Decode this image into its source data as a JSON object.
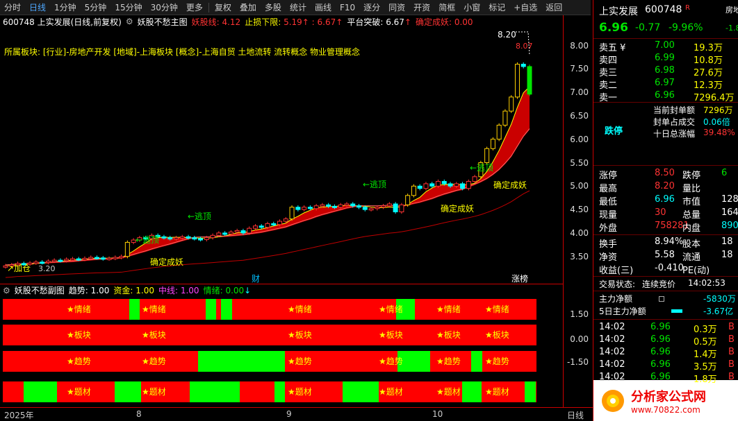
{
  "toolbar": {
    "items": [
      "分时",
      "日线",
      "1分钟",
      "5分钟",
      "15分钟",
      "30分钟",
      "更多"
    ],
    "items2": [
      "复权",
      "叠加",
      "多股",
      "统计",
      "画线",
      "F10",
      "逐分",
      "同资",
      "开资",
      "简框",
      "小窗",
      "标记",
      "+自选",
      "返回"
    ]
  },
  "info": {
    "code_name": "600748 上实发展(日线,前复权)",
    "indicator": "妖股不愁主图",
    "yao_label": "妖股线:",
    "yao_val": "4.12",
    "stop_label": "止损下限:",
    "stop_val": "5.19",
    "stop_val2": ": 6.67",
    "plat_label": "平台突破:",
    "plat_val": "6.67",
    "confirm_label": "确定成妖:",
    "confirm_val": "0.00"
  },
  "plate": "所属板块: [行业]-房地产开发 [地域]-上海板块 [概念]-上海自贸 土地流转 流转概念 物业管理概念",
  "annot": {
    "escape": "←逃顶",
    "confirm": "确定成妖",
    "buy": "↗加仓",
    "high": "8.20",
    "price8": "8.07",
    "low": "3.20",
    "cai": "财",
    "zb": "涨榜"
  },
  "yaxis": {
    "main": [
      "8.00",
      "7.50",
      "7.00",
      "6.50",
      "6.00",
      "5.50",
      "5.00",
      "4.50",
      "4.00",
      "3.50"
    ],
    "sub": [
      "1.50",
      "0.00",
      "-1.50"
    ]
  },
  "sub": {
    "title": "妖股不愁副图",
    "trend_label": "趋势:",
    "trend_val": "1.00",
    "fund_label": "资金:",
    "fund_val": "1.00",
    "mid_label": "中线:",
    "mid_val": "1.00",
    "mood_label": "情绪:",
    "mood_val": "0.00",
    "labels": [
      "★情绪",
      "★板块",
      "★趋势",
      "★题材"
    ]
  },
  "xaxis": {
    "labels": [
      "2025年",
      "8",
      "9",
      "10",
      "日线"
    ]
  },
  "right": {
    "title": "上实发展",
    "code": "600748",
    "r": "R",
    "ex": "房地",
    "price": "6.96",
    "chg": "-0.77",
    "pct": "-9.96%",
    "ex2": "-1.8",
    "asks": [
      {
        "l": "卖五 ¥",
        "p": "7.00",
        "v": "19.3万"
      },
      {
        "l": "卖四",
        "p": "6.99",
        "v": "10.8万"
      },
      {
        "l": "卖三",
        "p": "6.98",
        "v": "27.6万"
      },
      {
        "l": "卖二",
        "p": "6.97",
        "v": "12.3万"
      },
      {
        "l": "卖一",
        "p": "6.96",
        "v": "7296.4万"
      }
    ],
    "limit_label": "跌停",
    "seal_label": "当前封单额",
    "seal_val": "7296万",
    "seal_ratio_label": "封单占成交",
    "seal_ratio_val": "0.06倍",
    "ten_label": "十日总涨幅",
    "ten_val": "39.48%",
    "stats": [
      {
        "a": "涨停",
        "b": "8.50",
        "c": "跌停",
        "d": "6"
      },
      {
        "a": "最高",
        "b": "8.20",
        "c": "量比",
        "d": ""
      },
      {
        "a": "最低",
        "b": "6.96",
        "c": "市值",
        "d": "128"
      },
      {
        "a": "现量",
        "b": "30",
        "c": "总量",
        "d": "164"
      },
      {
        "a": "外盘",
        "b": "758281",
        "c": "内盘",
        "d": "890"
      }
    ],
    "stats2": [
      {
        "a": "换手",
        "b": "8.94%",
        "c": "股本",
        "d": "18"
      },
      {
        "a": "净资",
        "b": "5.58",
        "c": "流通",
        "d": "18"
      },
      {
        "a": "收益(三)",
        "b": "-0.410",
        "c": "PE(动)",
        "d": ""
      }
    ],
    "trade_label": "交易状态:",
    "trade_val": "连续竞价",
    "trade_time": "14:02:53",
    "flow1_label": "主力净额",
    "flow1_val": "-5830万",
    "flow2_label": "5日主力净额",
    "flow2_val": "-3.67亿",
    "ticks": [
      {
        "t": "14:02",
        "p": "6.96",
        "v": "0.3万",
        "s": "B"
      },
      {
        "t": "14:02",
        "p": "6.96",
        "v": "0.5万",
        "s": "B"
      },
      {
        "t": "14:02",
        "p": "6.96",
        "v": "1.4万",
        "s": "B"
      },
      {
        "t": "14:02",
        "p": "6.96",
        "v": "3.5万",
        "s": "B"
      },
      {
        "t": "14:02",
        "p": "6.96",
        "v": "1.8万",
        "s": "B"
      }
    ],
    "watermark": "分析家公式网",
    "watermark_url": "www.70822.com"
  },
  "chart_data": {
    "type": "candlestick",
    "title": "600748 上实发展(日线,前复权)",
    "ylim": [
      3.2,
      8.2
    ],
    "closes": [
      3.3,
      3.32,
      3.35,
      3.34,
      3.36,
      3.38,
      3.37,
      3.4,
      3.42,
      3.41,
      3.44,
      3.45,
      3.44,
      3.46,
      3.48,
      3.47,
      3.45,
      3.46,
      3.48,
      3.5,
      3.8,
      3.85,
      3.9,
      3.88,
      3.95,
      3.92,
      3.9,
      3.88,
      3.9,
      3.92,
      3.9,
      3.88,
      3.86,
      3.9,
      3.95,
      4.0,
      3.98,
      4.02,
      4.05,
      4.0,
      4.1,
      4.15,
      4.12,
      4.2,
      4.18,
      4.25,
      4.3,
      4.55,
      4.5,
      4.55,
      4.52,
      4.58,
      4.6,
      4.57,
      4.55,
      4.6,
      4.62,
      4.58,
      4.55,
      4.5,
      4.52,
      4.55,
      4.58,
      4.62,
      4.45,
      4.6,
      4.8,
      5.0,
      4.95,
      5.05,
      5.0,
      5.1,
      5.05,
      5.0,
      5.05,
      4.95,
      5.1,
      5.2,
      5.5,
      5.8,
      6.0,
      6.3,
      6.6,
      6.9,
      7.6,
      7.55,
      6.96
    ]
  }
}
